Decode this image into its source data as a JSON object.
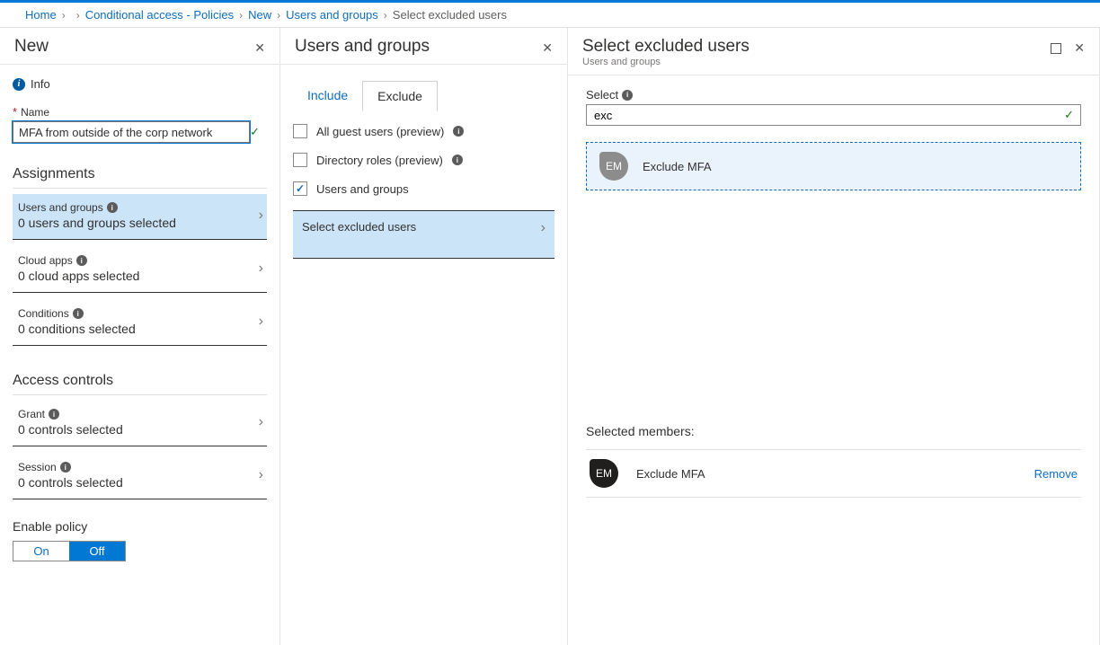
{
  "breadcrumb": {
    "home": "Home",
    "tenant": "",
    "policies": "Conditional access - Policies",
    "new": "New",
    "users_groups": "Users and groups",
    "current": "Select excluded users"
  },
  "blade1": {
    "title": "New",
    "info": "Info",
    "name_label": "Name",
    "name_value": "MFA from outside of the corp network",
    "assignments_h": "Assignments",
    "items": [
      {
        "title": "Users and groups",
        "sub": "0 users and groups selected",
        "selected": true
      },
      {
        "title": "Cloud apps",
        "sub": "0 cloud apps selected",
        "selected": false
      },
      {
        "title": "Conditions",
        "sub": "0 conditions selected",
        "selected": false
      }
    ],
    "access_h": "Access controls",
    "access_items": [
      {
        "title": "Grant",
        "sub": "0 controls selected"
      },
      {
        "title": "Session",
        "sub": "0 controls selected"
      }
    ],
    "enable_label": "Enable policy",
    "toggle_on": "On",
    "toggle_off": "Off"
  },
  "blade2": {
    "title": "Users and groups",
    "tab_include": "Include",
    "tab_exclude": "Exclude",
    "opt_guest": "All guest users (preview)",
    "opt_roles": "Directory roles (preview)",
    "opt_users": "Users and groups",
    "select_label": "Select excluded users"
  },
  "blade3": {
    "title": "Select excluded users",
    "subtitle": "Users and groups",
    "select_label": "Select",
    "search_value": "exc",
    "result_initials": "EM",
    "result_name": "Exclude MFA",
    "selected_h": "Selected members:",
    "selected_initials": "EM",
    "selected_name": "Exclude MFA",
    "remove": "Remove"
  }
}
